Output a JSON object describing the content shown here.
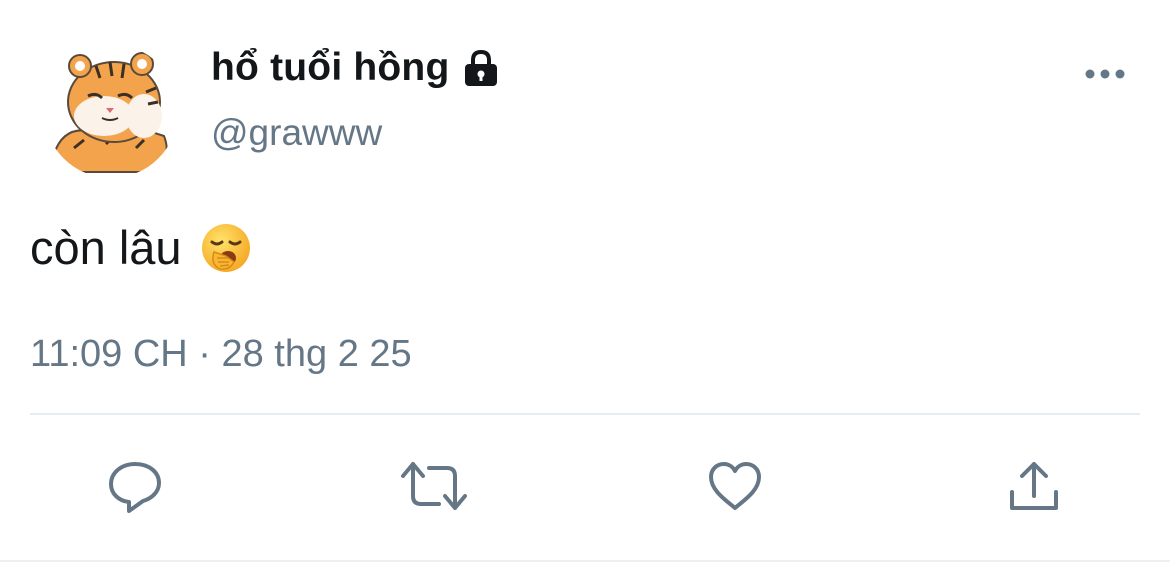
{
  "tweet": {
    "display_name": "hổ tuổi hồng",
    "handle": "@grawww",
    "text": "còn lâu",
    "timestamp": "11:09 CH · 28 thg 2 25",
    "protected_icon": "lock-icon",
    "emoji": "yawning-face-emoji"
  },
  "actions": {
    "reply_icon": "speech-bubble-icon",
    "retweet_icon": "retweet-icon",
    "like_icon": "heart-icon",
    "share_icon": "share-upload-icon",
    "more_icon": "more-dots-icon"
  },
  "colors": {
    "text_primary": "#14171a",
    "text_secondary": "#657786",
    "icon_gray": "#657786",
    "divider": "#e6ecf0"
  }
}
